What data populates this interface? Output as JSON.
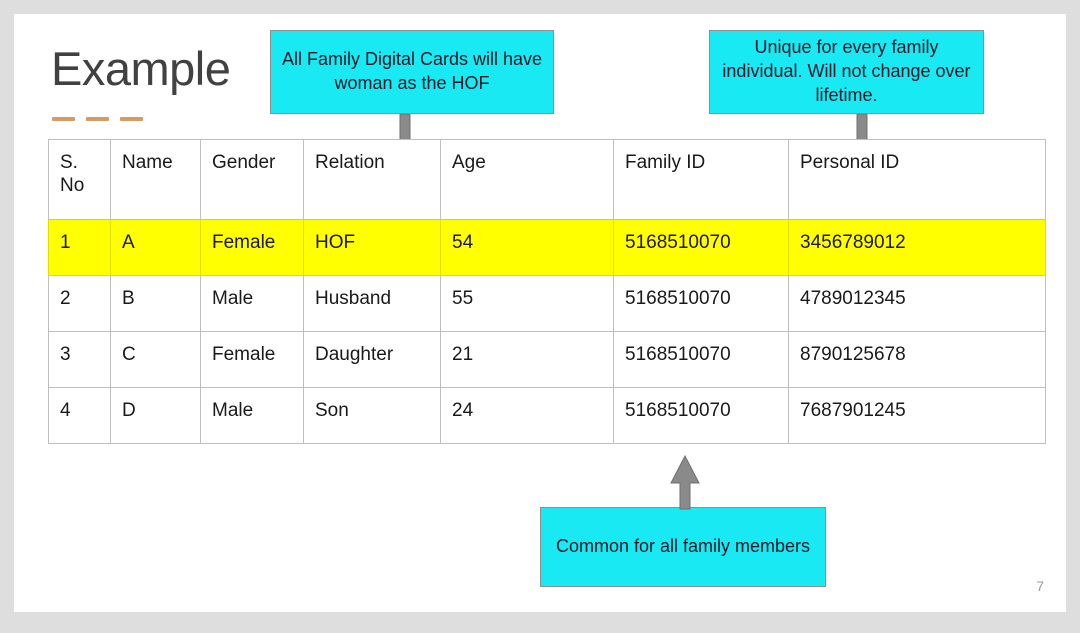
{
  "slide": {
    "title": "Example",
    "page_number": "7",
    "accent_color": "#d69a63",
    "callout_fill": "#19e9f2",
    "highlight_color": "#ffff00",
    "arrow_color": "#8a8a8a"
  },
  "callouts": {
    "hof": "All Family Digital Cards will have woman as the HOF",
    "unique": "Unique for every family individual. Will not change over lifetime.",
    "common": "Common for all family members"
  },
  "table": {
    "headers": [
      "S. No",
      "Name",
      "Gender",
      "Relation",
      "Age",
      "Family ID",
      "Personal ID"
    ],
    "rows": [
      {
        "highlight": true,
        "sno": "1",
        "name": "A",
        "gender": "Female",
        "relation": "HOF",
        "age": "54",
        "family_id": "5168510070",
        "personal_id": "3456789012"
      },
      {
        "highlight": false,
        "sno": "2",
        "name": "B",
        "gender": "Male",
        "relation": "Husband",
        "age": "55",
        "family_id": "5168510070",
        "personal_id": "4789012345"
      },
      {
        "highlight": false,
        "sno": "3",
        "name": "C",
        "gender": "Female",
        "relation": "Daughter",
        "age": "21",
        "family_id": "5168510070",
        "personal_id": "8790125678"
      },
      {
        "highlight": false,
        "sno": "4",
        "name": "D",
        "gender": "Male",
        "relation": "Son",
        "age": "24",
        "family_id": "5168510070",
        "personal_id": "7687901245"
      }
    ]
  }
}
